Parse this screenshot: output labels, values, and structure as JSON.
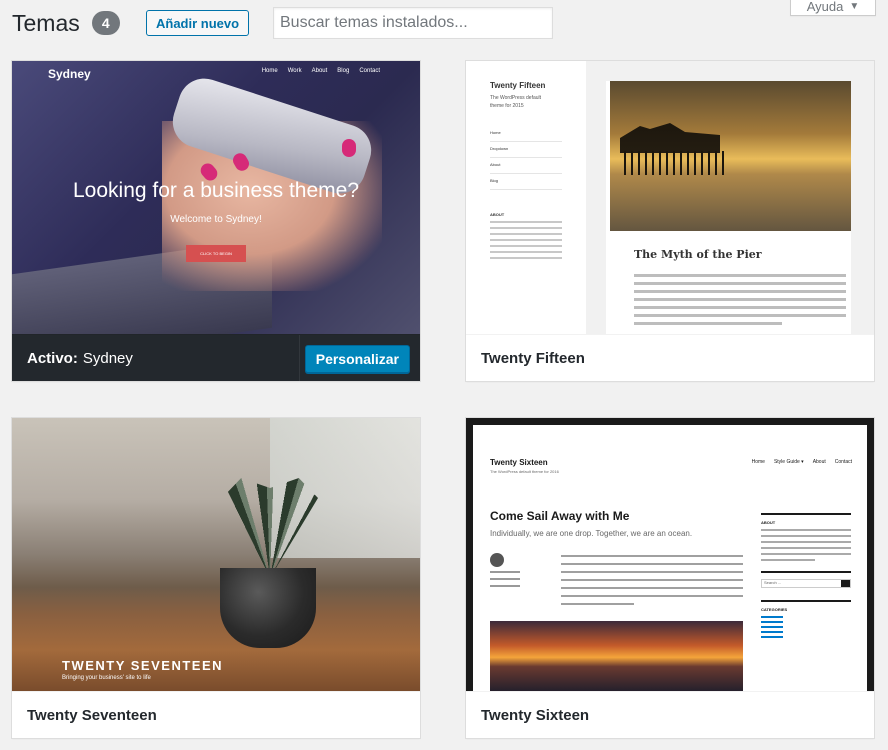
{
  "header": {
    "title": "Temas",
    "count": "4",
    "add_new_label": "Añadir nuevo",
    "search_placeholder": "Buscar temas instalados...",
    "help_label": "Ayuda"
  },
  "themes": [
    {
      "name": "Sydney",
      "active": true,
      "active_label": "Activo:",
      "customize_label": "Personalizar",
      "preview": {
        "site_title": "Sydney",
        "nav": [
          "Home",
          "Work",
          "About",
          "Blog",
          "Contact"
        ],
        "headline": "Looking for a business theme?",
        "subheadline": "Welcome to Sydney!",
        "button": "CLICK TO BEGIN"
      }
    },
    {
      "name": "Twenty Fifteen",
      "active": false,
      "preview": {
        "site_title": "Twenty Fifteen",
        "tagline": "The WordPress default theme for 2015",
        "menu": [
          "Home",
          "Dropdown",
          "About",
          "Blog"
        ],
        "widget_title": "ABOUT",
        "post_title": "The Myth of the Pier"
      }
    },
    {
      "name": "Twenty Seventeen",
      "active": false,
      "preview": {
        "site_title": "TWENTY SEVENTEEN",
        "tagline": "Bringing your business' site to life"
      }
    },
    {
      "name": "Twenty Sixteen",
      "active": false,
      "preview": {
        "site_title": "Twenty Sixteen",
        "tagline": "The WordPress default theme for 2016",
        "nav": [
          "Home",
          "Style Guide ▾",
          "About",
          "Contact"
        ],
        "post_title": "Come Sail Away with Me",
        "excerpt": "Individually, we are one drop. Together, we are an ocean.",
        "sidebar_about": "ABOUT",
        "sidebar_search": "Search ...",
        "sidebar_categories": "CATEGORIES"
      }
    }
  ],
  "colors": {
    "accent": "#0073aa",
    "primary_button": "#0085ba",
    "active_bar": "#23282d",
    "count_badge": "#72777c"
  }
}
